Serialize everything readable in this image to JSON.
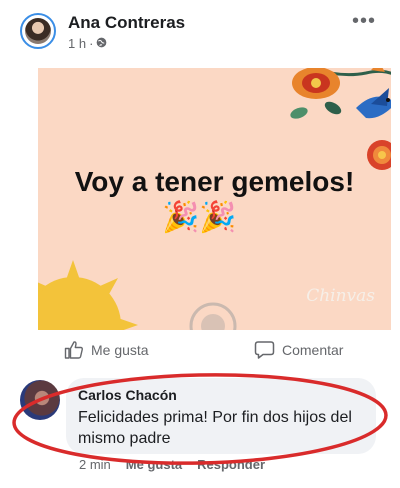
{
  "post": {
    "author": "Ana Contreras",
    "time": "1 h",
    "image_text": "Voy a tener gemelos!",
    "emoji": "🎉🎉",
    "brand": "Chinvas"
  },
  "actions": {
    "like": "Me gusta",
    "comment": "Comentar"
  },
  "comment": {
    "author": "Carlos Chacón",
    "text": "Felicidades prima! Por fin dos hijos del mismo padre",
    "time": "2 min",
    "like": "Me gusta",
    "reply": "Responder"
  },
  "icons": [
    "globe-icon",
    "more-icon",
    "like-icon",
    "comment-icon"
  ],
  "colors": {
    "image_bg": "#fbd8c4",
    "highlight": "#d92b2b",
    "avatar_ring": "#3b8ee6"
  }
}
